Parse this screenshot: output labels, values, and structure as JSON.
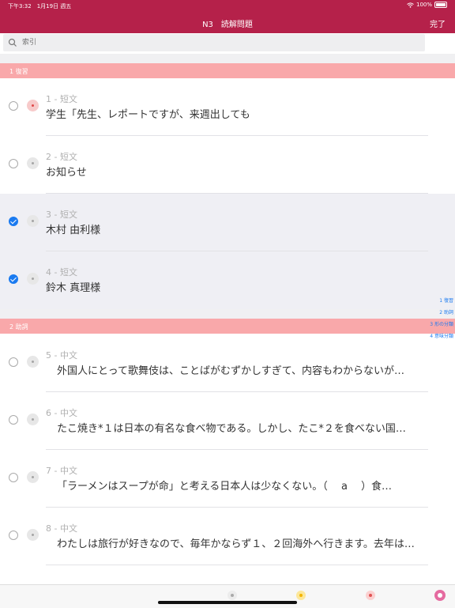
{
  "status": {
    "time": "下午3:32　1月19日 週五",
    "battery": "100%"
  },
  "nav": {
    "title": "N3　読解問題",
    "done": "完了"
  },
  "search": {
    "placeholder": "索引"
  },
  "sections": [
    {
      "label": "1 復習"
    },
    {
      "label": "2 助詞"
    }
  ],
  "rows": [
    {
      "meta": "1 - 短文",
      "text": "学生「先生、レポートですが、来週出しても",
      "checked": false
    },
    {
      "meta": "2 - 短文",
      "text": "お知らせ",
      "checked": false
    },
    {
      "meta": "3 - 短文",
      "text": "木村 由利様",
      "checked": true
    },
    {
      "meta": "4 - 短文",
      "text": "鈴木 真理様",
      "checked": true
    },
    {
      "meta": "5 - 中文",
      "text": "外国人にとって歌舞伎は、ことばがむずかしすぎて、内容もわからないが…",
      "checked": false
    },
    {
      "meta": "6 - 中文",
      "text": "たこ焼き*１は日本の有名な食べ物である。しかし、たこ*２を食べない国…",
      "checked": false
    },
    {
      "meta": "7 - 中文",
      "text": "「ラーメンはスープが命」と考える日本人は少なくない。（　 a　 ）食…",
      "checked": false
    },
    {
      "meta": "8 - 中文",
      "text": "わたしは旅行が好きなので、毎年かならず１、２回海外へ行きます。去年は…",
      "checked": false
    }
  ],
  "index": [
    "1 復習",
    "2 助詞",
    "3 形の分類",
    "4 意味分類"
  ],
  "colors": {
    "accent": "#b5214a",
    "section": "#f9a8aa",
    "check": "#1a7af0"
  }
}
